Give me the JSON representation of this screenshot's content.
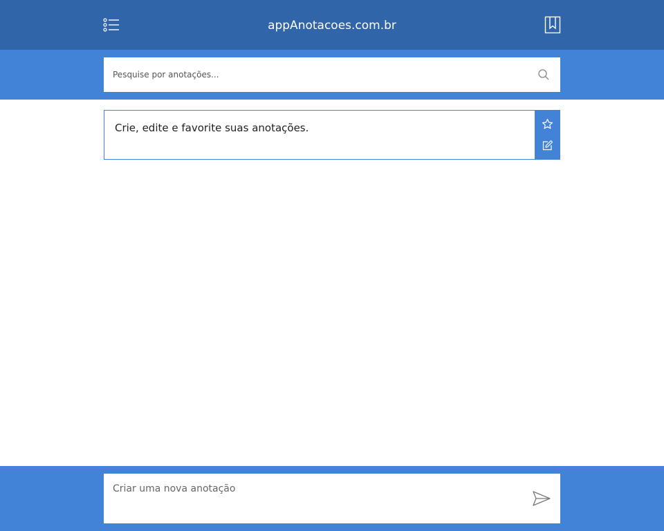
{
  "header": {
    "title": "appAnotacoes.com.br",
    "menu_icon": "list-icon",
    "bookmark_icon": "bookmark-icon"
  },
  "search": {
    "placeholder": "Pesquise por anotações...",
    "icon": "search-icon"
  },
  "notes": [
    {
      "text": "Crie, edite e favorite suas anotações.",
      "favorite_icon": "star-icon",
      "edit_icon": "edit-icon"
    }
  ],
  "composer": {
    "placeholder": "Criar uma nova anotação",
    "send_icon": "send-icon"
  },
  "colors": {
    "header_bg": "#3065aa",
    "accent": "#4283d8",
    "background": "#ffffff"
  }
}
